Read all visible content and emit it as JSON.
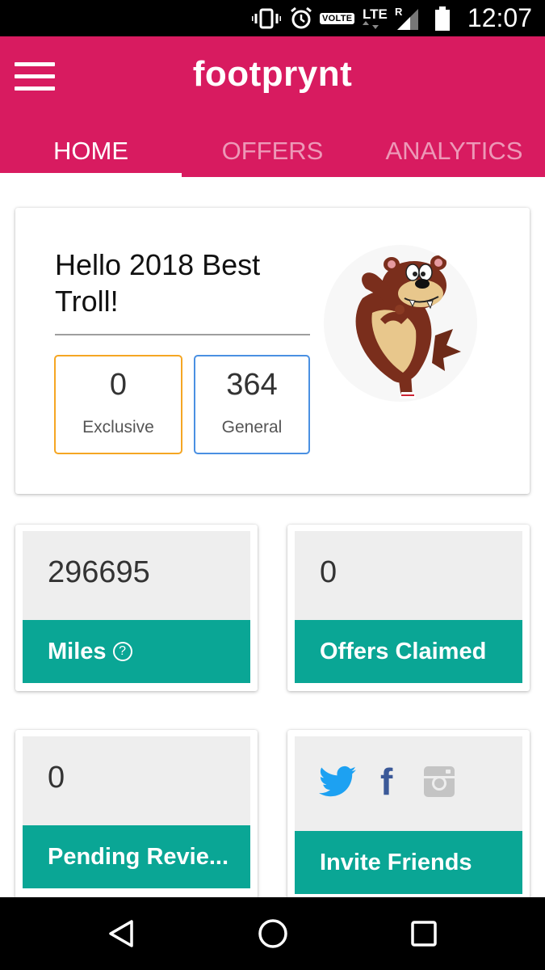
{
  "status_bar": {
    "volte": "VOLTE",
    "network": "LTE",
    "roaming": "R",
    "time": "12:07"
  },
  "app_bar": {
    "title": "footprynt",
    "tabs": [
      {
        "label": "HOME",
        "active": true
      },
      {
        "label": "OFFERS",
        "active": false
      },
      {
        "label": "ANALYTICS",
        "active": false
      }
    ]
  },
  "greeting": {
    "text": "Hello 2018 Best Troll!",
    "exclusive": {
      "value": "0",
      "label": "Exclusive"
    },
    "general": {
      "value": "364",
      "label": "General"
    }
  },
  "stats": {
    "miles": {
      "value": "296695",
      "label": "Miles"
    },
    "offers_claimed": {
      "value": "0",
      "label": "Offers Claimed"
    },
    "pending_reviews": {
      "value": "0",
      "label": "Pending Revie..."
    },
    "invite": {
      "label": "Invite Friends",
      "icons": [
        "twitter-icon",
        "facebook-icon",
        "instagram-icon"
      ]
    }
  },
  "colors": {
    "primary": "#d81b60",
    "accent": "#0aa695",
    "exclusive_border": "#f5a623",
    "general_border": "#4a90e2"
  }
}
